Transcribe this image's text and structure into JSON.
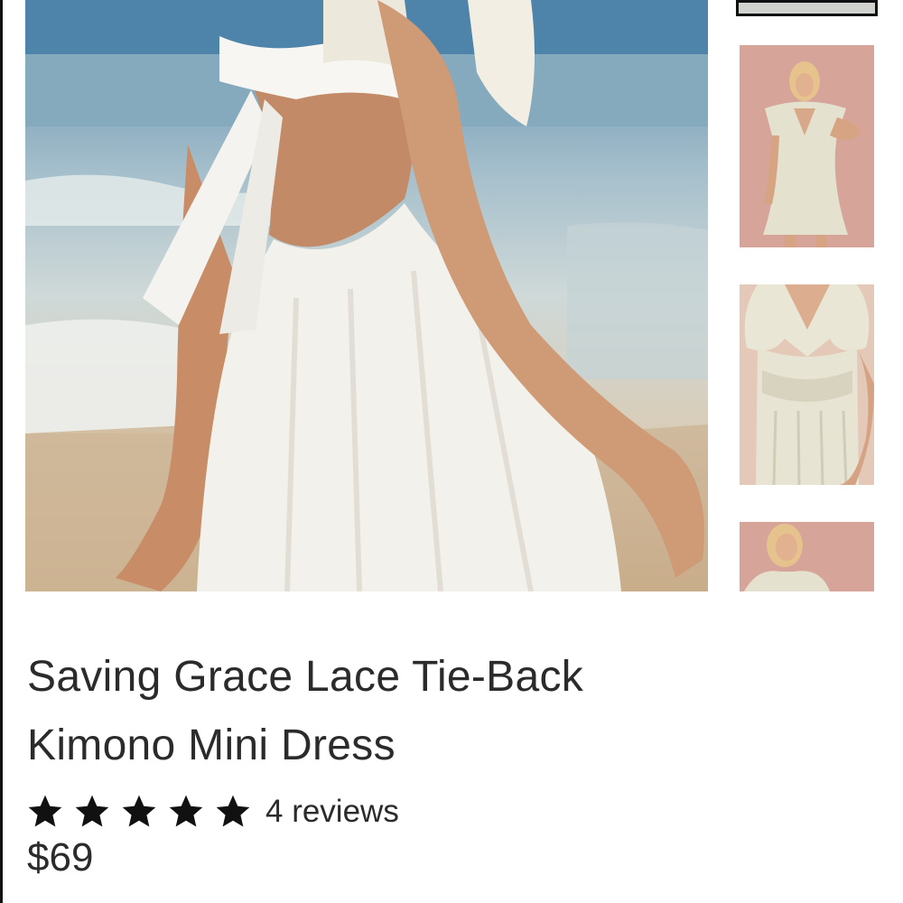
{
  "product": {
    "title_line1": "Saving Grace Lace Tie-Back",
    "title_line2": "Kimono Mini Dress",
    "rating": {
      "stars": 5,
      "max": 5,
      "reviews_label": "4 reviews"
    },
    "price": "$69"
  },
  "gallery": {
    "main_image": "beach-back-view-white-dress",
    "thumbnails": [
      "selected-thumbnail",
      "front-view-pink-background",
      "lace-closeup-front",
      "front-portrait-pink-background"
    ]
  },
  "colors": {
    "text": "#2b2b2b",
    "star": "#111111",
    "thumb_bg": "#d9a79d",
    "selected_border": "#111111"
  }
}
